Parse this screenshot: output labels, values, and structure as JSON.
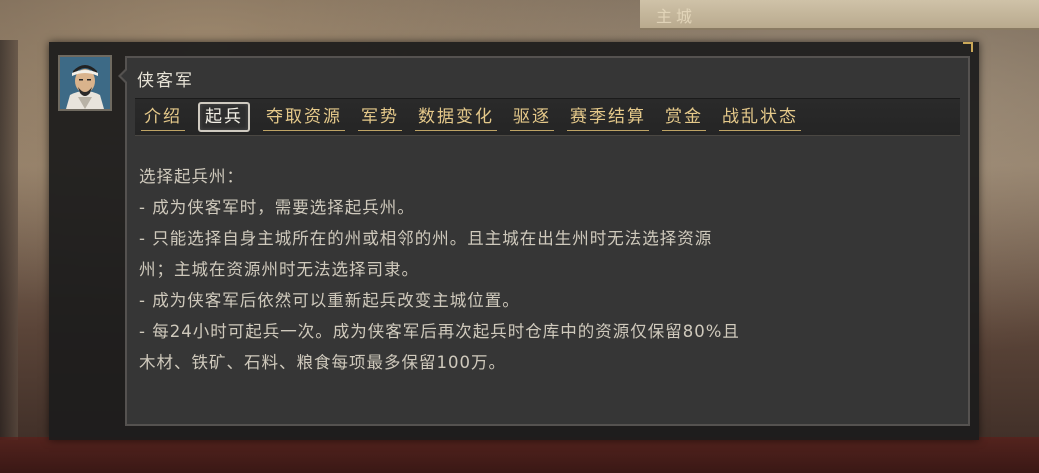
{
  "background": {
    "banner_text": "主城"
  },
  "panel": {
    "title": "侠客军",
    "avatar": "general-portrait",
    "tabs": [
      {
        "label": "介绍",
        "active": false
      },
      {
        "label": "起兵",
        "active": true
      },
      {
        "label": "夺取资源",
        "active": false
      },
      {
        "label": "军势",
        "active": false
      },
      {
        "label": "数据变化",
        "active": false
      },
      {
        "label": "驱逐",
        "active": false
      },
      {
        "label": "赛季结算",
        "active": false
      },
      {
        "label": "赏金",
        "active": false
      },
      {
        "label": "战乱状态",
        "active": false
      }
    ],
    "content": {
      "heading": "选择起兵州：",
      "lines": [
        "- 成为侠客军时，需要选择起兵州。",
        "- 只能选择自身主城所在的州或相邻的州。且主城在出生州时无法选择资源",
        "州；主城在资源州时无法选择司隶。",
        "- 成为侠客军后依然可以重新起兵改变主城位置。",
        "- 每24小时可起兵一次。成为侠客军后再次起兵时仓库中的资源仅保留80%且",
        "木材、铁矿、石料、粮食每项最多保留100万。"
      ]
    }
  },
  "colors": {
    "tab_text": "#e5c98a",
    "active_tab_text": "#f3f0e6",
    "body_text": "#cfc9bc",
    "panel_bg": "#363636"
  }
}
